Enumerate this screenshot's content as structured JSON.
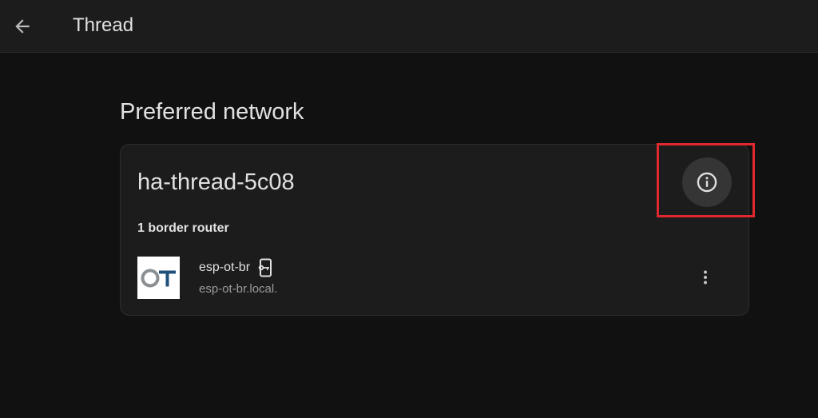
{
  "toolbar": {
    "back_icon": "arrow-left-icon",
    "title": "Thread"
  },
  "section": {
    "title": "Preferred network"
  },
  "network": {
    "name": "ha-thread-5c08",
    "info_icon": "info-circle-icon",
    "border_router_count_label": "1 border router",
    "routers": [
      {
        "logo_text": "OT",
        "name": "esp-ot-br",
        "name_icon": "device-key-icon",
        "host": "esp-ot-br.local.",
        "menu_icon": "more-vertical-icon"
      }
    ]
  },
  "colors": {
    "background": "#111111",
    "card": "#1c1c1c",
    "highlight": "#e0282e",
    "logo_grey": "#8a8f94",
    "logo_blue": "#1f4f7a"
  }
}
